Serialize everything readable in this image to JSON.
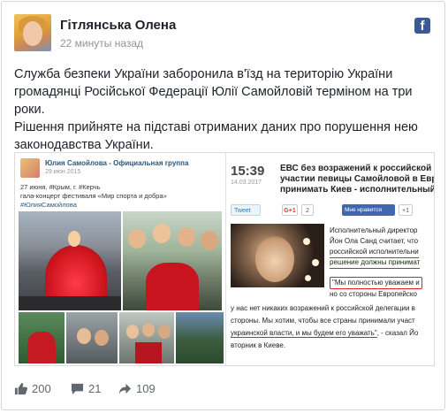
{
  "post": {
    "author": "Гітлянська Олена",
    "time": "22 минуты назад",
    "fb_logo": "f",
    "paragraph1": "Служба безпеки України заборонила в'їзд на територію України громадянці Російської Федерації Юлії Самойловій терміном на три роки.",
    "paragraph2": "Рішення прийняте на підставі отриманих даних про порушення нею законодавства України."
  },
  "vk": {
    "group": "Юлия Самойлова - Официальная группа",
    "date": "29 июн 2015",
    "line1": "27 июня, #Крым, г. #Керчь",
    "line2": "гала-концерт фестиваля «Мир спорта и добра»",
    "line3": "#ЮлияСамойлова"
  },
  "news": {
    "time": "15:39",
    "date": "14.03.2017",
    "title1": "ЕВС без возражений к российской де",
    "title2": "участии певицы Самойловой в Евро",
    "title3": "принимать Киев - исполнительный д",
    "tweet": "Tweet",
    "gplus": "G+1",
    "gcount": "2",
    "fblike": "Мне нравится",
    "fbcount": "+1",
    "body1": "Исполнительный директор",
    "body2": "Йон Ола Санд считает, что",
    "body3": "российской исполнительни",
    "body4": "решение должны принимат",
    "body5": "\"Мы полностью уважаем и",
    "body6": "но со стороны Европейско",
    "body7": "у нас нет никаких возражений к российской делегации в",
    "body8": "стороны. Мы хотим, чтобы все страны принимали участ",
    "body9": "украинской власти, и мы будем его уважать\"",
    "body9b": ", - сказал Йо",
    "body10": "вторник в Киеве."
  },
  "stats": {
    "likes": "200",
    "comments": "21",
    "shares": "109"
  },
  "colors": {
    "text": "#1d2129",
    "meta": "#90949c",
    "facebook": "#3b5998",
    "icons": "#606770"
  }
}
